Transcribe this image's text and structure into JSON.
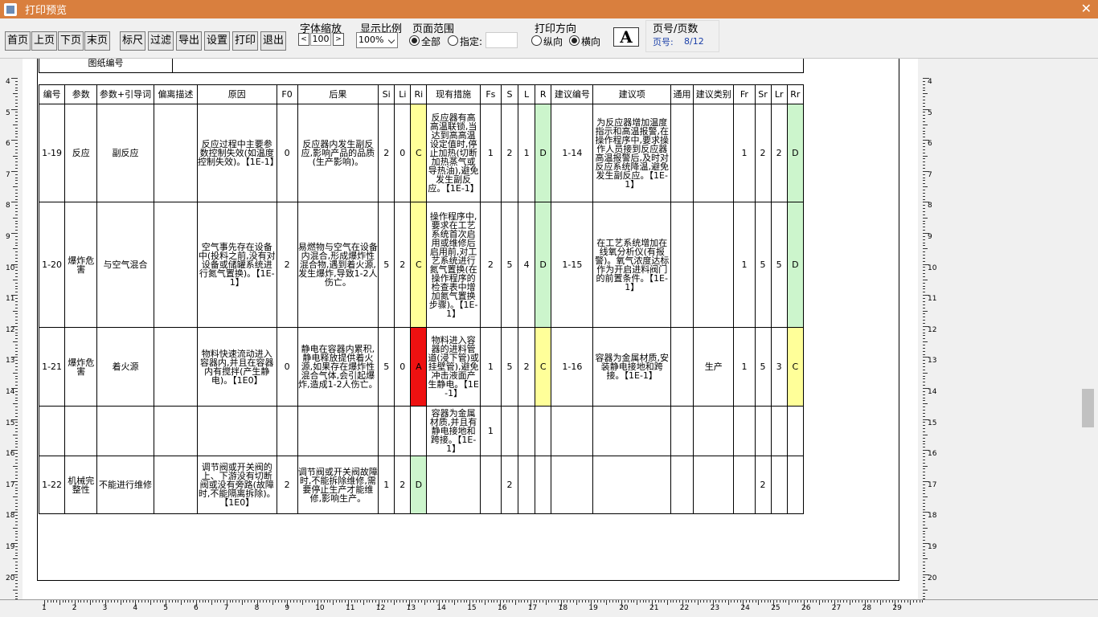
{
  "window": {
    "title": "打印预览",
    "close": "✕"
  },
  "toolbar": {
    "buttons": [
      "首页",
      "上页",
      "下页",
      "末页",
      "标尺",
      "过滤",
      "导出",
      "设置",
      "打印",
      "退出"
    ],
    "font_zoom": {
      "label": "字体缩放",
      "value": "100",
      "dec": "<",
      "inc": ">"
    },
    "display_ratio": {
      "label": "显示比例",
      "value": "100%"
    },
    "page_range": {
      "label": "页面范围",
      "all": "全部",
      "specify": "指定:"
    },
    "orientation": {
      "label": "打印方向",
      "portrait": "纵向",
      "landscape": "横向"
    },
    "font_button": "A",
    "page_info": {
      "label": "页号/页数",
      "page_label": "页号:",
      "page_value": "8/12"
    }
  },
  "sheet": {
    "drawing_no_label": "图纸编号"
  },
  "table": {
    "headers": [
      "编号",
      "参数",
      "参数+引导词",
      "偏离描述",
      "原因",
      "F0",
      "后果",
      "Si",
      "Li",
      "Ri",
      "现有措施",
      "Fs",
      "S",
      "L",
      "R",
      "建议编号",
      "建议项",
      "通用",
      "建议类别",
      "Fr",
      "Sr",
      "Lr",
      "Rr"
    ],
    "rows": [
      {
        "id": "1-19",
        "param": "反应",
        "guide": "副反应",
        "dev": "",
        "cause": "反应过程中主要参数控制失效(如温度控制失效)。【1E-1】",
        "f0": "0",
        "conseq": "反应器内发生副反应,影响产品的品质(生产影响)。",
        "si": "2",
        "li": "0",
        "ri": "C",
        "measure": "反应器有高高温联锁,当达到高高温设定值时,停止加热(切断加热蒸气或导热油),避免发生副反应。【1E-1】",
        "fs": "1",
        "s": "2",
        "l": "1",
        "r": "D",
        "sug_no": "1-14",
        "sug": "为反应器增加温度指示和高温报警,在操作程序中,要求操作人员接到反应器高温报警后,及时对反应系统降温,避免发生副反应。【1E-1】",
        "gen": "",
        "cat": "",
        "fr": "1",
        "sr": "2",
        "lr": "2",
        "rr": "D"
      },
      {
        "id": "1-20",
        "param": "爆炸危害",
        "guide": "与空气混合",
        "dev": "",
        "cause": "空气事先存在设备中(投料之前,没有对设备或储罐系统进行氮气置换)。【1E-1】",
        "f0": "2",
        "conseq": "易燃物与空气在设备内混合,形成爆炸性混合物,遇到着火源,发生爆炸,导致1-2人伤亡。",
        "si": "5",
        "li": "2",
        "ri": "C",
        "measure": "操作程序中,要求在工艺系统首次启用或维修后启用前,对工艺系统进行氮气置换(在操作程序的检查表中增加氮气置换步骤)。【1E-1】",
        "fs": "2",
        "s": "5",
        "l": "4",
        "r": "D",
        "sug_no": "1-15",
        "sug": "在工艺系统增加在线氧分析仪(有报警)。氧气浓度达标作为开启进料阀门的前置条件。【1E-1】",
        "gen": "",
        "cat": "",
        "fr": "1",
        "sr": "5",
        "lr": "5",
        "rr": "D"
      },
      {
        "id": "1-21",
        "param": "爆炸危害",
        "guide": "着火源",
        "dev": "",
        "cause": "物料快速流动进入容器内,并且在容器内有搅拌(产生静电)。【1E0】",
        "f0": "0",
        "conseq": "静电在容器内累积,静电释放提供着火源,如果存在爆炸性混合气体,会引起爆炸,造成1-2人伤亡。",
        "si": "5",
        "li": "0",
        "ri": "A",
        "measure": "物料进入容器的进料管道(浸下管)或挂壁管),避免冲击液面产生静电。【1E-1】",
        "fs": "1",
        "s": "5",
        "l": "2",
        "r": "C",
        "sug_no": "1-16",
        "sug": "容器为金属材质,安装静电接地和跨接。【1E-1】",
        "gen": "",
        "cat": "生产",
        "fr": "1",
        "sr": "5",
        "lr": "3",
        "rr": "C"
      },
      {
        "sub": true,
        "measure": "容器为金属材质,并且有静电接地和跨接。【1E-1】",
        "fs": "1"
      },
      {
        "id": "1-22",
        "param": "机械完整性",
        "guide": "不能进行维修",
        "dev": "",
        "cause": "调节阀或开关阀的上、下游没有切断阀或没有旁路(故障时,不能隔离拆除)。【1E0】",
        "f0": "2",
        "conseq": "调节阀或开关阀故障时,不能拆除维修,需要停止生产才能维修,影响生产。",
        "si": "1",
        "li": "2",
        "ri": "D",
        "measure": "",
        "fs": "",
        "s": "2",
        "l": "",
        "r": "",
        "sug_no": "",
        "sug": "",
        "gen": "",
        "cat": "",
        "fr": "",
        "sr": "2",
        "lr": "",
        "rr": ""
      }
    ],
    "colors": {
      "A": "#ee1111",
      "C": "#ffff99",
      "D": "#ccf5cc"
    }
  },
  "ruler": {
    "v_ticks": [
      "4",
      "5",
      "6",
      "7",
      "8",
      "9",
      "10",
      "11",
      "12",
      "13",
      "14",
      "15",
      "16",
      "17",
      "18",
      "19",
      "20"
    ],
    "h_ticks": [
      "1",
      "2",
      "3",
      "4",
      "5",
      "6",
      "7",
      "8",
      "9",
      "10",
      "11",
      "12",
      "13",
      "14",
      "15",
      "16",
      "17",
      "18",
      "19",
      "20",
      "21",
      "22",
      "23",
      "24",
      "25",
      "26",
      "27",
      "28",
      "29"
    ]
  }
}
